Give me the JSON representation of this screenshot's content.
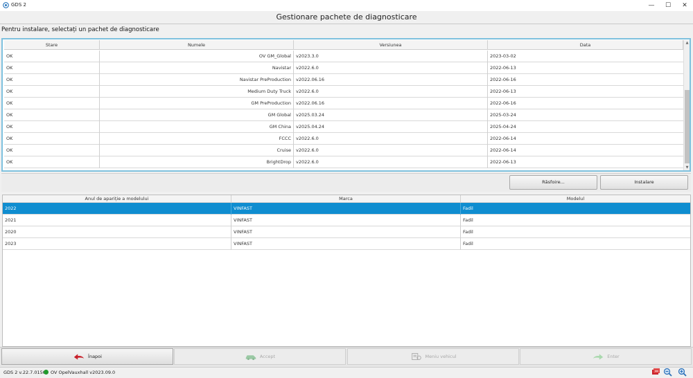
{
  "window": {
    "title": "GDS 2"
  },
  "header": {
    "page_title": "Gestionare pachete de diagnosticare",
    "instruction": "Pentru instalare, selectați un pachet de diagnosticare"
  },
  "packages": {
    "columns": [
      "Stare",
      "Numele",
      "Versiunea",
      "Data"
    ],
    "rows": [
      {
        "status": "OK",
        "name": "OV GM_Global",
        "version": "v2023.3.0",
        "date": "2023-03-02"
      },
      {
        "status": "OK",
        "name": "Navistar",
        "version": "v2022.6.0",
        "date": "2022-06-13"
      },
      {
        "status": "OK",
        "name": "Navistar PreProduction",
        "version": "v2022.06.16",
        "date": "2022-06-16"
      },
      {
        "status": "OK",
        "name": "Medium Duty Truck",
        "version": "v2022.6.0",
        "date": "2022-06-13"
      },
      {
        "status": "OK",
        "name": "GM PreProduction",
        "version": "v2022.06.16",
        "date": "2022-06-16"
      },
      {
        "status": "OK",
        "name": "GM Global",
        "version": "v2025.03.24",
        "date": "2025-03-24"
      },
      {
        "status": "OK",
        "name": "GM China",
        "version": "v2025.04.24",
        "date": "2025-04-24"
      },
      {
        "status": "OK",
        "name": "FCCC",
        "version": "v2022.6.0",
        "date": "2022-06-14"
      },
      {
        "status": "OK",
        "name": "Cruise",
        "version": "v2022.6.0",
        "date": "2022-06-14"
      },
      {
        "status": "OK",
        "name": "BrightDrop",
        "version": "v2022.6.0",
        "date": "2022-06-13"
      }
    ]
  },
  "actions": {
    "browse_label": "Răsfoire...",
    "install_label": "Instalare"
  },
  "models": {
    "columns": [
      "Anul de apariție a modelului",
      "Marca",
      "Modelul"
    ],
    "selected_index": 0,
    "rows": [
      {
        "year": "2022",
        "make": "VINFAST",
        "model": "Fadil"
      },
      {
        "year": "2021",
        "make": "VINFAST",
        "model": "Fadil"
      },
      {
        "year": "2020",
        "make": "VINFAST",
        "model": "Fadil"
      },
      {
        "year": "2023",
        "make": "VINFAST",
        "model": "Fadil"
      }
    ]
  },
  "nav": {
    "back_label": "Înapoi",
    "accept_label": "Accept",
    "vehicle_menu_label": "Meniu vehicul",
    "enter_label": "Enter"
  },
  "status": {
    "app_version": "GDS 2 v.22.7.01500",
    "package": "OV OpelVauxhall  v2023.09.0"
  },
  "colors": {
    "selection": "#0f8dd0",
    "frame_accent": "#7ec1de",
    "status_ok": "#1f9a2c"
  }
}
